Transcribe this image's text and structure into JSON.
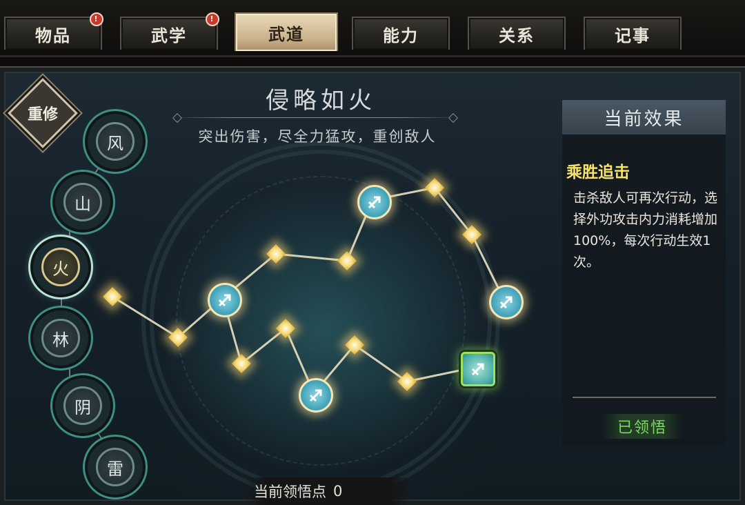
{
  "tabs": [
    {
      "label": "物品",
      "badge": "!",
      "active": false
    },
    {
      "label": "武学",
      "badge": "!",
      "active": false
    },
    {
      "label": "武道",
      "badge": "",
      "active": true
    },
    {
      "label": "能力",
      "badge": "",
      "active": false
    },
    {
      "label": "关系",
      "badge": "",
      "active": false
    },
    {
      "label": "记事",
      "badge": "",
      "active": false
    }
  ],
  "reset_label": "重修",
  "styles": [
    {
      "label": "风",
      "active": false
    },
    {
      "label": "山",
      "active": false
    },
    {
      "label": "火",
      "active": true
    },
    {
      "label": "林",
      "active": false
    },
    {
      "label": "阴",
      "active": false
    },
    {
      "label": "雷",
      "active": false
    }
  ],
  "title": "侵略如火",
  "subtitle": "突出伤害，尽全力猛攻，重创敌人",
  "effect": {
    "header": "当前效果",
    "name": "乘胜追击",
    "description": "击杀敌人可再次行动，选择外功攻击内力消耗增加100%，每次行动生效1次。",
    "status": "已领悟"
  },
  "points": {
    "label": "当前领悟点",
    "value": "0"
  },
  "colors": {
    "highlight": "#f7e26a",
    "learned": "#79dd5c",
    "active_tab": "#c8b08a"
  },
  "icons": {
    "skill_node": "sword-arrow-icon",
    "star_node": "glowing-star-icon"
  }
}
